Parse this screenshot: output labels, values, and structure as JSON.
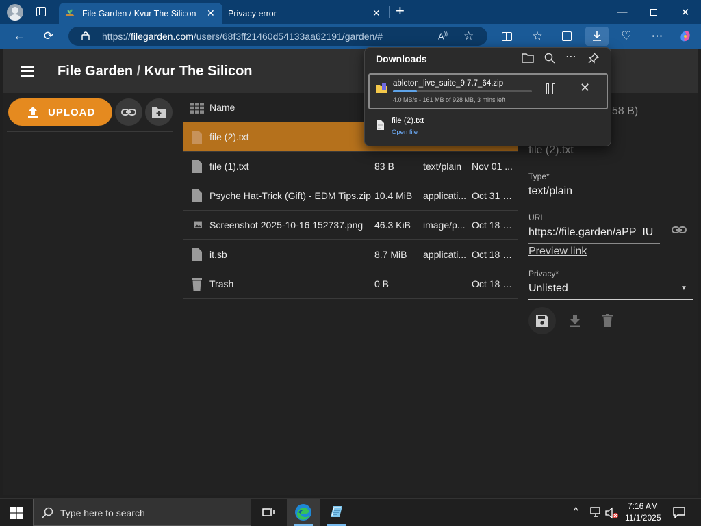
{
  "browser": {
    "tabs": [
      {
        "title": "File Garden / Kvur The Silicon",
        "active": true
      },
      {
        "title": "Privacy error",
        "active": false
      }
    ],
    "url_prefix": "https://",
    "url_host": "filegarden.com",
    "url_path": "/users/68f3ff21460d54133aa62191/garden/#"
  },
  "app": {
    "breadcrumb_root": "File Garden",
    "breadcrumb_sep": "/",
    "breadcrumb_user": "Kvur The Silicon",
    "upload_label": "UPLOAD"
  },
  "table": {
    "header_name": "Name",
    "rows": [
      {
        "name": "file (2).txt",
        "size": "",
        "type": "",
        "date": "",
        "icon": "file-icon",
        "selected": true
      },
      {
        "name": "file (1).txt",
        "size": "83 B",
        "type": "text/plain",
        "date": "Nov 01 ...",
        "icon": "file-icon"
      },
      {
        "name": "Psyche Hat-Trick (Gift) - EDM Tips.zip",
        "size": "10.4 MiB",
        "type": "applicati...",
        "date": "Oct 31 2...",
        "icon": "file-icon"
      },
      {
        "name": "Screenshot 2025-10-16 152737.png",
        "size": "46.3 KiB",
        "type": "image/p...",
        "date": "Oct 18 2...",
        "icon": "image-icon"
      },
      {
        "name": "it.sb",
        "size": "8.7 MiB",
        "type": "applicati...",
        "date": "Oct 18 2...",
        "icon": "file-icon"
      },
      {
        "name": "Trash",
        "size": "0 B",
        "type": "",
        "date": "Oct 18 2...",
        "icon": "trash-icon"
      }
    ]
  },
  "details": {
    "size_partial": "258 B)",
    "name_value": "file (2).txt",
    "type_label": "Type*",
    "type_value": "text/plain",
    "url_label": "URL",
    "url_value": "https://file.garden/aPP_IU",
    "preview_link": "Preview link",
    "privacy_label": "Privacy*",
    "privacy_value": "Unlisted"
  },
  "downloads": {
    "title": "Downloads",
    "items": [
      {
        "filename": "ableton_live_suite_9.7.7_64.zip",
        "status": "4.0 MB/s - 161 MB of 928 MB, 3 mins left",
        "progress": 0.17
      },
      {
        "filename": "file (2).txt",
        "action": "Open file"
      }
    ]
  },
  "taskbar": {
    "search_placeholder": "Type here to search",
    "time": "7:16 AM",
    "date": "11/1/2025"
  },
  "colors": {
    "accent_orange": "#e58a1f",
    "selected_row": "#b5711c",
    "tab_bar": "#0b3d6e",
    "address_bar": "#1a5a97"
  }
}
